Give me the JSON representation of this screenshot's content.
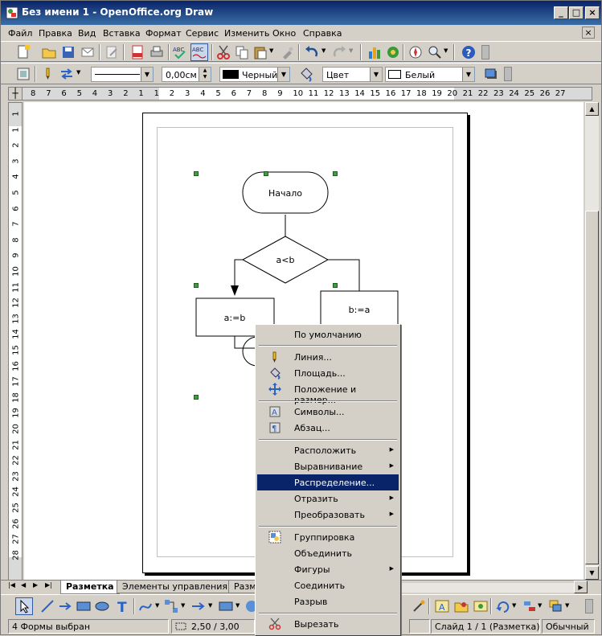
{
  "window": {
    "title": "Без имени 1 - OpenOffice.org Draw"
  },
  "menubar": [
    {
      "label": "Файл"
    },
    {
      "label": "Правка"
    },
    {
      "label": "Вид"
    },
    {
      "label": "Вставка"
    },
    {
      "label": "Формат"
    },
    {
      "label": "Сервис"
    },
    {
      "label": "Изменить"
    },
    {
      "label": "Окно"
    },
    {
      "label": "Справка"
    }
  ],
  "line_toolbar": {
    "line_width": "0,00см",
    "line_color": "Черный",
    "area_style": "Цвет",
    "area_color": "Белый"
  },
  "ruler": {
    "h": [
      "8",
      "7",
      "6",
      "5",
      "4",
      "3",
      "2",
      "1",
      "1",
      "2",
      "3",
      "4",
      "5",
      "6",
      "7",
      "8",
      "9",
      "10",
      "11",
      "12",
      "13",
      "14",
      "15",
      "16",
      "17",
      "18",
      "19",
      "20",
      "21",
      "22",
      "23",
      "24",
      "25",
      "26",
      "27"
    ],
    "v": [
      "1",
      "1",
      "2",
      "3",
      "4",
      "5",
      "6",
      "7",
      "8",
      "9",
      "10",
      "11",
      "12",
      "13",
      "14",
      "15",
      "16",
      "17",
      "18",
      "19",
      "20",
      "21",
      "22",
      "23",
      "24",
      "25",
      "26",
      "27",
      "28"
    ]
  },
  "diagram": {
    "start": "Начало",
    "condition": "a<b",
    "left_box": "a:=b",
    "right_box": "b:=a"
  },
  "tabs": [
    {
      "label": "Разметка"
    },
    {
      "label": "Элементы управления"
    },
    {
      "label": "Разм"
    }
  ],
  "context_menu": [
    {
      "label": "По умолчанию",
      "icon": "",
      "submenu": false
    },
    {
      "label": "Линия...",
      "icon": "pen-icon",
      "submenu": false
    },
    {
      "label": "Площадь...",
      "icon": "paint-bucket-icon",
      "submenu": false
    },
    {
      "label": "Положение и размер...",
      "icon": "move-icon",
      "submenu": false
    },
    {
      "label": "Символы...",
      "icon": "character-icon",
      "submenu": false
    },
    {
      "label": "Абзац...",
      "icon": "paragraph-icon",
      "submenu": false
    },
    {
      "label": "Расположить",
      "icon": "",
      "submenu": true
    },
    {
      "label": "Выравнивание",
      "icon": "",
      "submenu": true
    },
    {
      "label": "Распределение...",
      "icon": "",
      "submenu": false,
      "highlighted": true
    },
    {
      "label": "Отразить",
      "icon": "",
      "submenu": true
    },
    {
      "label": "Преобразовать",
      "icon": "",
      "submenu": true
    },
    {
      "label": "Группировка",
      "icon": "group-icon",
      "submenu": false
    },
    {
      "label": "Объединить",
      "icon": "",
      "submenu": false
    },
    {
      "label": "Фигуры",
      "icon": "",
      "submenu": true
    },
    {
      "label": "Соединить",
      "icon": "",
      "submenu": false
    },
    {
      "label": "Разрыв",
      "icon": "",
      "submenu": false
    },
    {
      "label": "Вырезать",
      "icon": "scissors-icon",
      "submenu": false
    }
  ],
  "status": {
    "selection": "4 Формы выбран",
    "position": "2,50 / 3,00",
    "slide": "Слайд 1 / 1 (Разметка)",
    "style": "Обычный"
  },
  "colors": {
    "titlebar": "#0a246a",
    "highlight": "#0a246a",
    "handle": "#3c9f3c"
  }
}
